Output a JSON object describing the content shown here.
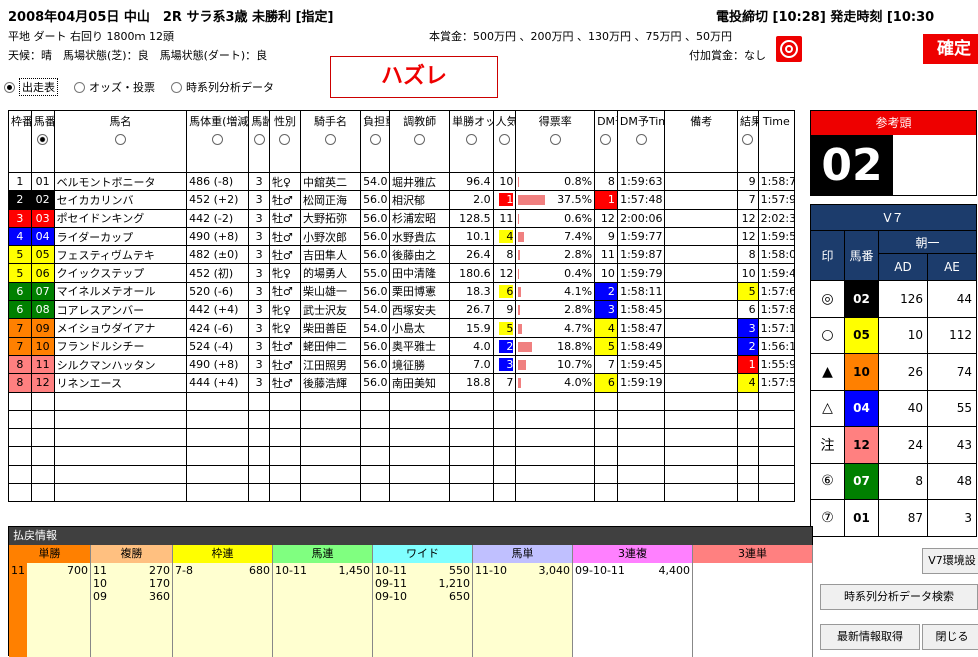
{
  "header": {
    "title": "2008年04月05日 中山　2R サラ系3歳 未勝利 [指定]",
    "line2": "平地 ダート 右回り 1800ｍ 12頭",
    "line3": "天候：晴　馬場状態(芝)：良　馬場状態(ダート)：良",
    "deadline": "電投締切 [10:28] 発走時刻 [10:30",
    "prize": "本賞金：500万円 、200万円 、130万円 、75万円 、50万円",
    "add_prize": "付加賞金：なし",
    "kakutei": "確定"
  },
  "tabs": [
    {
      "label": "出走表",
      "on": true
    },
    {
      "label": "オッズ・投票",
      "on": false
    },
    {
      "label": "時系列分析データ",
      "on": false
    }
  ],
  "result_label": "ハズレ",
  "table": {
    "headers": [
      "枠番",
      "馬番",
      "馬名",
      "馬体重(増減)",
      "馬齢",
      "性別",
      "騎手名",
      "負担重量",
      "調教師",
      "単勝オッズ",
      "人気",
      "得票率",
      "DM予",
      "DM予Time",
      "備考",
      "結果",
      "Time"
    ],
    "rows": [
      {
        "waku": "1",
        "uma": "01",
        "name": "ベルモントボニータ",
        "weight": "486 (-8)",
        "age": "3",
        "sex": "牝♀",
        "jockey": "中舘英二",
        "load": "54.0",
        "trainer": "堀井雅広",
        "odds": "96.4",
        "pop": "10",
        "rate": "0.8%",
        "rate_v": 0.8,
        "dm": "8",
        "dmtime": "1:59:63",
        "note": "",
        "res": "9",
        "time": "1:58:7"
      },
      {
        "waku": "2",
        "uma": "02",
        "name": "セイカカリンバ",
        "weight": "452 (+2)",
        "age": "3",
        "sex": "牡♂",
        "jockey": "松岡正海",
        "load": "56.0",
        "trainer": "相沢郁",
        "odds": "2.0",
        "pop": "1",
        "rate": "37.5%",
        "rate_v": 37.5,
        "dm": "1",
        "dmtime": "1:57:48",
        "note": "",
        "res": "7",
        "time": "1:57:9"
      },
      {
        "waku": "3",
        "uma": "03",
        "name": "ポセイドンキング",
        "weight": "442 (-2)",
        "age": "3",
        "sex": "牡♂",
        "jockey": "大野拓弥",
        "load": "56.0",
        "trainer": "杉浦宏昭",
        "odds": "128.5",
        "pop": "11",
        "rate": "0.6%",
        "rate_v": 0.6,
        "dm": "12",
        "dmtime": "2:00:06",
        "note": "",
        "res": "12",
        "time": "2:02:3"
      },
      {
        "waku": "4",
        "uma": "04",
        "name": "ライダーカップ",
        "weight": "490 (+8)",
        "age": "3",
        "sex": "牡♂",
        "jockey": "小野次郎",
        "load": "56.0",
        "trainer": "水野貴広",
        "odds": "10.1",
        "pop": "4",
        "rate": "7.4%",
        "rate_v": 7.4,
        "dm": "9",
        "dmtime": "1:59:77",
        "note": "",
        "res": "12",
        "time": "1:59:5"
      },
      {
        "waku": "5",
        "uma": "05",
        "name": "フェスティヴムテキ",
        "weight": "482 (±0)",
        "age": "3",
        "sex": "牡♂",
        "jockey": "吉田隼人",
        "load": "56.0",
        "trainer": "後藤由之",
        "odds": "26.4",
        "pop": "8",
        "rate": "2.8%",
        "rate_v": 2.8,
        "dm": "11",
        "dmtime": "1:59:87",
        "note": "",
        "res": "8",
        "time": "1:58:0"
      },
      {
        "waku": "5",
        "uma": "06",
        "name": "クイックステップ",
        "weight": "452 (初)",
        "age": "3",
        "sex": "牝♀",
        "jockey": "的場勇人",
        "load": "55.0",
        "trainer": "田中清隆",
        "odds": "180.6",
        "pop": "12",
        "rate": "0.4%",
        "rate_v": 0.4,
        "dm": "10",
        "dmtime": "1:59:79",
        "note": "",
        "res": "10",
        "time": "1:59:4"
      },
      {
        "waku": "6",
        "uma": "07",
        "name": "マイネルメテオール",
        "weight": "520 (-6)",
        "age": "3",
        "sex": "牡♂",
        "jockey": "柴山雄一",
        "load": "56.0",
        "trainer": "栗田博憲",
        "odds": "18.3",
        "pop": "6",
        "rate": "4.1%",
        "rate_v": 4.1,
        "dm": "2",
        "dmtime": "1:58:11",
        "note": "",
        "res": "5",
        "time": "1:57:6"
      },
      {
        "waku": "6",
        "uma": "08",
        "name": "コアレスアンバー",
        "weight": "442 (+4)",
        "age": "3",
        "sex": "牝♀",
        "jockey": "武士沢友",
        "load": "54.0",
        "trainer": "西塚安夫",
        "odds": "26.7",
        "pop": "9",
        "rate": "2.8%",
        "rate_v": 2.8,
        "dm": "3",
        "dmtime": "1:58:45",
        "note": "",
        "res": "6",
        "time": "1:57:8"
      },
      {
        "waku": "7",
        "uma": "09",
        "name": "メイショウダイアナ",
        "weight": "424 (-6)",
        "age": "3",
        "sex": "牝♀",
        "jockey": "柴田善臣",
        "load": "54.0",
        "trainer": "小島太",
        "odds": "15.9",
        "pop": "5",
        "rate": "4.7%",
        "rate_v": 4.7,
        "dm": "4",
        "dmtime": "1:58:47",
        "note": "",
        "res": "3",
        "time": "1:57:1"
      },
      {
        "waku": "7",
        "uma": "10",
        "name": "フランドルシチー",
        "weight": "524 (-4)",
        "age": "3",
        "sex": "牡♂",
        "jockey": "蛯田伸二",
        "load": "56.0",
        "trainer": "奥平雅士",
        "odds": "4.0",
        "pop": "2",
        "rate": "18.8%",
        "rate_v": 18.8,
        "dm": "5",
        "dmtime": "1:58:49",
        "note": "",
        "res": "2",
        "time": "1:56:1"
      },
      {
        "waku": "8",
        "uma": "11",
        "name": "シルクマンハッタン",
        "weight": "490 (+8)",
        "age": "3",
        "sex": "牡♂",
        "jockey": "江田照男",
        "load": "56.0",
        "trainer": "境征勝",
        "odds": "7.0",
        "pop": "3",
        "rate": "10.7%",
        "rate_v": 10.7,
        "dm": "7",
        "dmtime": "1:59:45",
        "note": "",
        "res": "1",
        "time": "1:55:9"
      },
      {
        "waku": "8",
        "uma": "12",
        "name": "リネンエース",
        "weight": "444 (+4)",
        "age": "3",
        "sex": "牡♂",
        "jockey": "後藤浩輝",
        "load": "56.0",
        "trainer": "南田美知",
        "odds": "18.8",
        "pop": "7",
        "rate": "4.0%",
        "rate_v": 4.0,
        "dm": "6",
        "dmtime": "1:59:19",
        "note": "",
        "res": "4",
        "time": "1:57:5"
      }
    ]
  },
  "colors": {
    "waku1": "#ffffff",
    "waku2": "#000000",
    "waku3": "#ff0000",
    "waku4": "#0000ff",
    "waku5": "#ffff00",
    "waku6": "#008000",
    "waku7": "#ff8000",
    "waku8": "#ff8080"
  },
  "reference": {
    "title": "参考頭",
    "number": "02"
  },
  "v7": {
    "title": "V７",
    "sub": "朝一",
    "headers": [
      "印",
      "馬番",
      "AD",
      "AE"
    ],
    "rows": [
      {
        "mark": "◎",
        "uma": "02",
        "ad": "126",
        "ae": "44"
      },
      {
        "mark": "○",
        "uma": "05",
        "ad": "10",
        "ae": "112"
      },
      {
        "mark": "▲",
        "uma": "10",
        "ad": "26",
        "ae": "74"
      },
      {
        "mark": "△",
        "uma": "04",
        "ad": "40",
        "ae": "55"
      },
      {
        "mark": "注",
        "uma": "12",
        "ad": "24",
        "ae": "43"
      },
      {
        "mark": "⑥",
        "uma": "07",
        "ad": "8",
        "ae": "48"
      },
      {
        "mark": "⑦",
        "uma": "01",
        "ad": "87",
        "ae": "3"
      }
    ]
  },
  "payout": {
    "title": "払戻情報",
    "cols": [
      {
        "label": "単勝",
        "color": "#ff8000",
        "rows": [
          [
            "11",
            "700"
          ]
        ]
      },
      {
        "label": "複勝",
        "color": "#ffc080",
        "rows": [
          [
            "11",
            "270"
          ],
          [
            "10",
            "170"
          ],
          [
            "09",
            "360"
          ]
        ]
      },
      {
        "label": "枠連",
        "color": "#ffff00",
        "rows": [
          [
            "7-8",
            "680"
          ]
        ]
      },
      {
        "label": "馬連",
        "color": "#80ff80",
        "rows": [
          [
            "10-11",
            "1,450"
          ]
        ]
      },
      {
        "label": "ワイド",
        "color": "#80ffff",
        "rows": [
          [
            "10-11",
            "550"
          ],
          [
            "09-11",
            "1,210"
          ],
          [
            "09-10",
            "650"
          ]
        ]
      },
      {
        "label": "馬単",
        "color": "#c0c0ff",
        "rows": [
          [
            "11-10",
            "3,040"
          ]
        ]
      },
      {
        "label": "3連複",
        "color": "#ff80ff",
        "rows": [
          [
            "09-10-11",
            "4,400"
          ]
        ]
      },
      {
        "label": "3連単",
        "color": "#ff8080",
        "rows": []
      }
    ]
  },
  "buttons": {
    "v7env": "V7環境設",
    "ts_search": "時系列分析データ検索",
    "latest": "最新情報取得",
    "close": "閉じる"
  }
}
